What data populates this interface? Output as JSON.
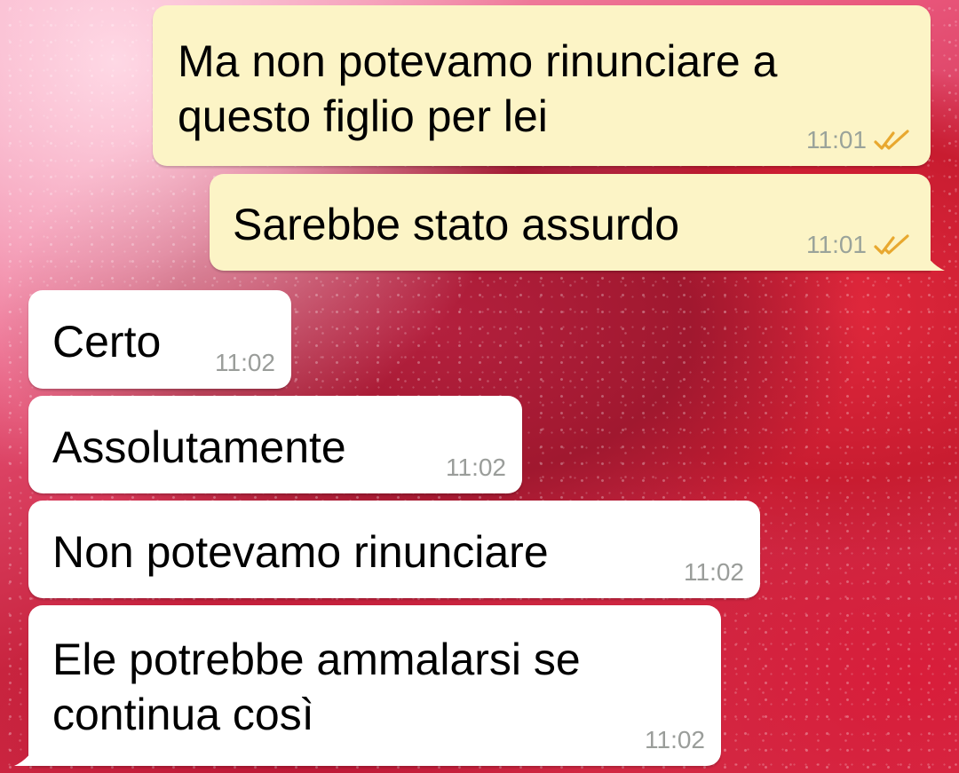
{
  "messages": [
    {
      "direction": "outgoing",
      "text": "Ma non potevamo rinunciare a questo figlio per lei",
      "time": "11:01",
      "status_icon": "double-check-icon"
    },
    {
      "direction": "outgoing",
      "text": "Sarebbe stato assurdo",
      "time": "11:01",
      "status_icon": "double-check-icon"
    },
    {
      "direction": "incoming",
      "text": "Certo",
      "time": "11:02"
    },
    {
      "direction": "incoming",
      "text": "Assolutamente",
      "time": "11:02"
    },
    {
      "direction": "incoming",
      "text": "Non potevamo rinunciare",
      "time": "11:02"
    },
    {
      "direction": "incoming",
      "text": "Ele potrebbe ammalarsi se continua così",
      "time": "11:02"
    }
  ],
  "colors": {
    "outgoing_bubble": "#fcf4c6",
    "incoming_bubble": "#ffffff",
    "timestamp": "#9aa39a",
    "read_ticks": "#e8a82f"
  }
}
